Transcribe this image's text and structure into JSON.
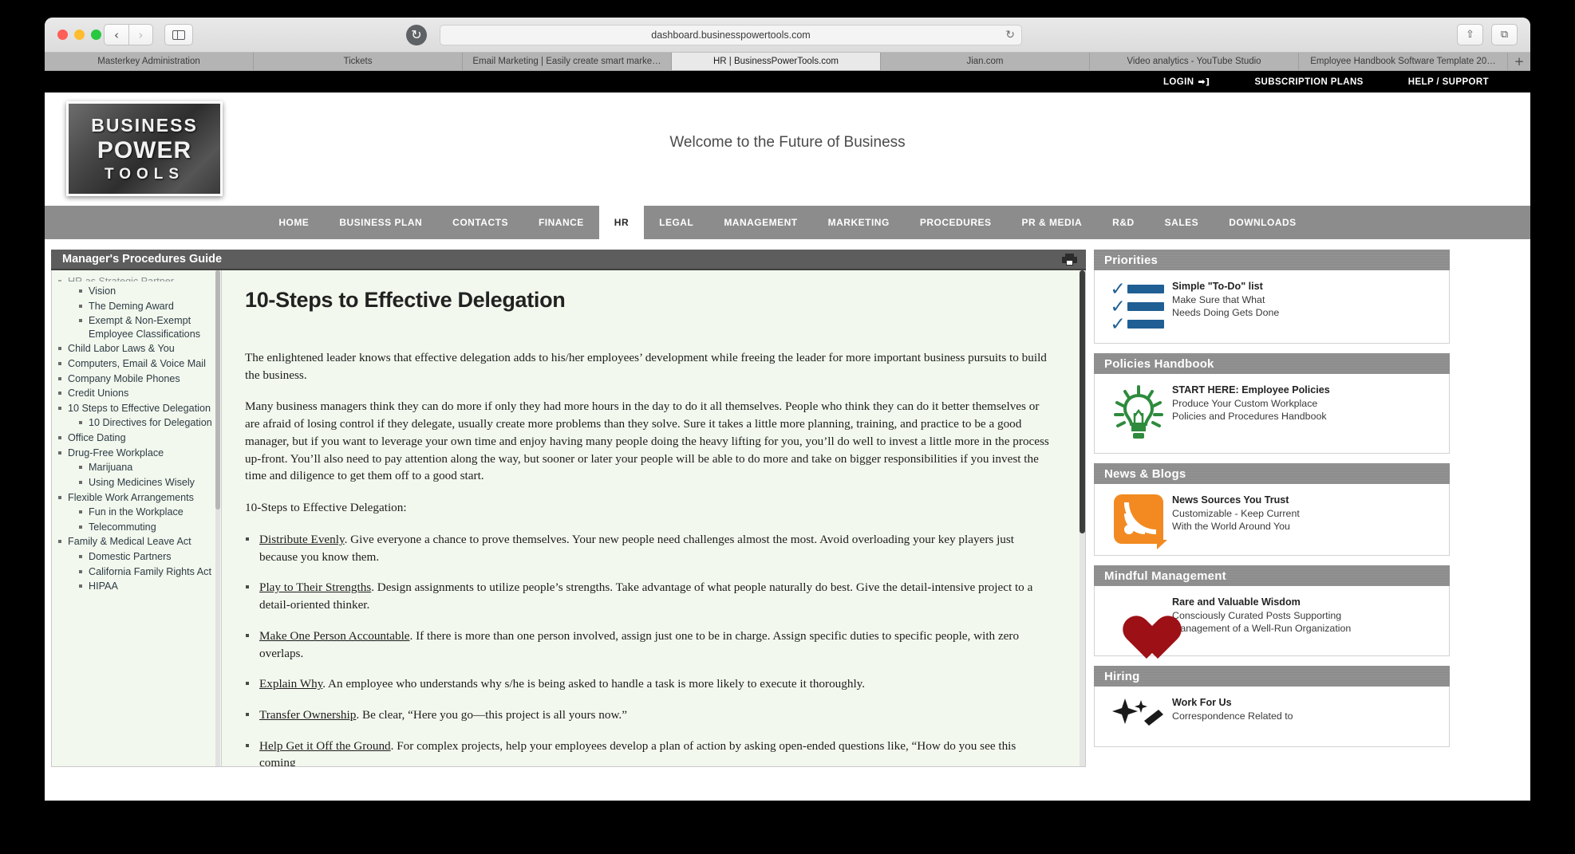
{
  "browser": {
    "url": "dashboard.businesspowertools.com",
    "reload_glyph": "↻",
    "back_glyph": "‹",
    "forward_glyph": "›",
    "share_glyph": "⇧",
    "tabs_glyph": "⧉",
    "new_tab_glyph": "+",
    "tabs": [
      {
        "label": "Masterkey Administration",
        "active": false
      },
      {
        "label": "Tickets",
        "active": false
      },
      {
        "label": "Email Marketing | Easily create smart marke…",
        "active": false
      },
      {
        "label": "HR | BusinessPowerTools.com",
        "active": true
      },
      {
        "label": "Jian.com",
        "active": false
      },
      {
        "label": "Video analytics - YouTube Studio",
        "active": false
      },
      {
        "label": "Employee Handbook Software Template 20…",
        "active": false
      }
    ]
  },
  "topbar": {
    "login": "LOGIN",
    "login_arrow": "➡]",
    "subscription": "SUBSCRIPTION PLANS",
    "help": "HELP / SUPPORT"
  },
  "masthead": {
    "logo_line1": "BUSINESS",
    "logo_line2": "POWER",
    "logo_line3": "TOOLS",
    "logo_mark": "®",
    "welcome": "Welcome to the Future of Business"
  },
  "mainnav": {
    "items": [
      {
        "label": "HOME",
        "active": false
      },
      {
        "label": "BUSINESS PLAN",
        "active": false
      },
      {
        "label": "CONTACTS",
        "active": false
      },
      {
        "label": "FINANCE",
        "active": false
      },
      {
        "label": "HR",
        "active": true
      },
      {
        "label": "LEGAL",
        "active": false
      },
      {
        "label": "MANAGEMENT",
        "active": false
      },
      {
        "label": "MARKETING",
        "active": false
      },
      {
        "label": "PROCEDURES",
        "active": false
      },
      {
        "label": "PR & MEDIA",
        "active": false
      },
      {
        "label": "R&D",
        "active": false
      },
      {
        "label": "SALES",
        "active": false
      },
      {
        "label": "DOWNLOADS",
        "active": false
      }
    ]
  },
  "guide": {
    "header_title": "Manager's Procedures Guide",
    "print_icon": "print-icon"
  },
  "tree": {
    "clipped_top": "HR as Strategic Partner",
    "items": [
      {
        "label": "Vision",
        "level": 2
      },
      {
        "label": "The Deming Award",
        "level": 2
      },
      {
        "label": "Exempt & Non-Exempt Employee Classifications",
        "level": 2
      },
      {
        "label": "Child Labor Laws & You",
        "level": 1
      },
      {
        "label": "Computers, Email & Voice Mail",
        "level": 1
      },
      {
        "label": "Company Mobile Phones",
        "level": 1
      },
      {
        "label": "Credit Unions",
        "level": 1
      },
      {
        "label": "10 Steps to Effective Delegation",
        "level": 1
      },
      {
        "label": "10 Directives for Delegation",
        "level": 2
      },
      {
        "label": "Office Dating",
        "level": 1
      },
      {
        "label": "Drug-Free Workplace",
        "level": 1
      },
      {
        "label": "Marijuana",
        "level": 2
      },
      {
        "label": "Using Medicines Wisely",
        "level": 2
      },
      {
        "label": "Flexible Work Arrangements",
        "level": 1
      },
      {
        "label": "Fun in the Workplace",
        "level": 2
      },
      {
        "label": "Telecommuting",
        "level": 2
      },
      {
        "label": "Family & Medical Leave Act",
        "level": 1
      },
      {
        "label": "Domestic Partners",
        "level": 2
      },
      {
        "label": "California Family Rights Act",
        "level": 2
      },
      {
        "label": "HIPAA",
        "level": 2
      }
    ]
  },
  "article": {
    "title": "10-Steps to Effective Delegation",
    "paragraphs": [
      "The enlightened leader knows that effective delegation adds to his/her employees’ development while freeing the leader for more important business pursuits to build the business.",
      "Many business managers think they can do more if only they had more hours in the day to do it all themselves. People who think they can do it better themselves or are afraid of losing control if they delegate, usually create more problems than they solve. Sure it takes a little more planning, training, and practice to be a good manager, but if you want to leverage your own time and enjoy having many people doing the heavy lifting for you, you’ll do well to invest a little more in the process up-front. You’ll also need to pay attention along the way, but sooner or later your people will be able to do more and take on bigger responsibilities if you invest the time and diligence to get them off to a good start.",
      "10-Steps to Effective Delegation:"
    ],
    "steps": [
      {
        "lead": "Distribute Evenly",
        "body": ". Give everyone a chance to prove themselves. Your new people need challenges almost the most. Avoid overloading your key players just because you know them."
      },
      {
        "lead": "Play to Their Strengths",
        "body": ". Design assignments to utilize people’s strengths. Take advantage of what people naturally do best. Give the detail-intensive project to a detail-oriented thinker."
      },
      {
        "lead": "Make One Person Accountable",
        "body": ". If there is more than one person involved, assign just one to be in charge. Assign specific duties to specific people, with zero overlaps."
      },
      {
        "lead": "Explain Why",
        "body": ". An employee who understands why s/he is being asked to handle a task is more likely to execute it thoroughly."
      },
      {
        "lead": "Transfer Ownership",
        "body": ". Be clear, “Here you go—this project is all yours now.”"
      },
      {
        "lead": "Help Get it Off the Ground",
        "body": ". For complex projects, help your employees develop a plan of action by asking open-ended questions like, “How do you see this coming"
      }
    ]
  },
  "widgets": [
    {
      "heading": "Priorities",
      "icon": "checklist-icon",
      "title": "Simple \"To-Do\" list",
      "lines": [
        "Make Sure that What",
        "Needs Doing Gets Done"
      ]
    },
    {
      "heading": "Policies Handbook",
      "icon": "lightbulb-icon",
      "title": "START HERE: Employee Policies",
      "lines": [
        "Produce Your Custom Workplace",
        "Policies and Procedures Handbook"
      ]
    },
    {
      "heading": "News & Blogs",
      "icon": "rss-icon",
      "title": "News Sources You Trust",
      "lines": [
        "Customizable - Keep Current",
        "With the World Around You"
      ]
    },
    {
      "heading": "Mindful Management",
      "icon": "heart-icon",
      "title": "Rare and Valuable Wisdom",
      "lines": [
        "Consciously Curated Posts Supporting",
        "Management of a Well-Run Organization"
      ]
    },
    {
      "heading": "Hiring",
      "icon": "sparkle-pencil-icon",
      "title": "Work For Us",
      "lines": [
        "Correspondence Related to"
      ]
    }
  ],
  "colors": {
    "nav_gray": "#8c8c8c",
    "widget_head_gray": "#898989",
    "content_bg": "#f2f8ed",
    "accent_blue": "#1f5f94",
    "accent_orange": "#f28a21",
    "accent_green": "#2e8b3d",
    "accent_red": "#9d1016"
  }
}
